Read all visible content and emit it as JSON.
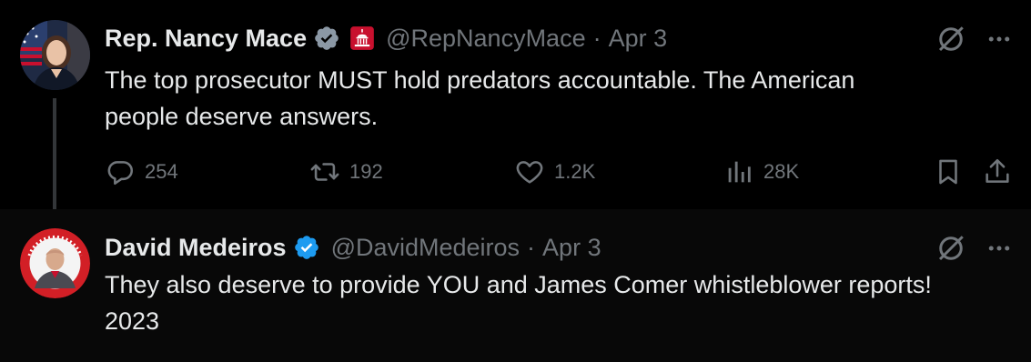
{
  "tweets": [
    {
      "author": {
        "name": "Rep. Nancy Mace",
        "handle": "@RepNancyMace",
        "verified": true,
        "government_badge": true
      },
      "separator": "·",
      "date": "Apr 3",
      "text_line1": "The top prosecutor MUST hold predators accountable. The American",
      "text_line2": "people deserve answers.",
      "stats": {
        "replies": "254",
        "reposts": "192",
        "likes": "1.2K",
        "views": "28K"
      }
    },
    {
      "author": {
        "name": "David Medeiros",
        "handle": "@DavidMedeiros",
        "verified": true,
        "avatar_ring_text": "A.S.L RESOURCES"
      },
      "separator": "·",
      "date": "Apr 3",
      "text_line1": "They also deserve to provide YOU and James Comer whistleblower reports!",
      "text_line2": "2023"
    }
  ],
  "icons": {
    "verified": "verified-badge-icon",
    "government": "capitol-icon",
    "grok": "grok-icon",
    "more": "more-icon",
    "reply": "reply-icon",
    "repost": "repost-icon",
    "like": "heart-icon",
    "views": "views-icon",
    "bookmark": "bookmark-icon",
    "share": "share-icon"
  },
  "colors": {
    "background": "#000000",
    "text": "#e7e9ea",
    "muted": "#71767b",
    "verified": "#1d9bf0",
    "government_badge": "#c8102e",
    "thread_line": "#333639"
  }
}
